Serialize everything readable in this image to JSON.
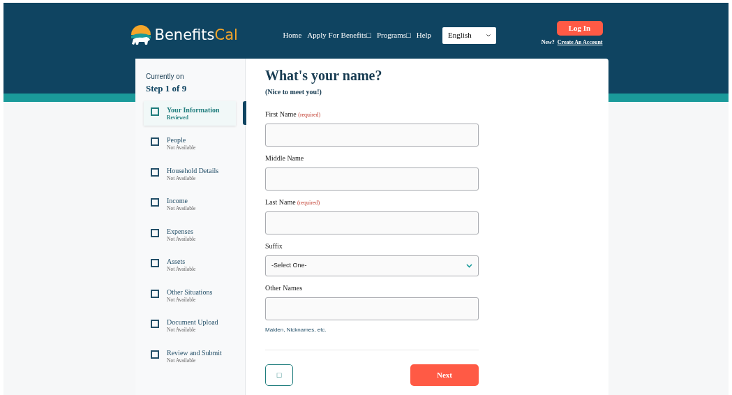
{
  "header": {
    "logo_text": "Benefits",
    "logo_accent": "Cal",
    "nav": [
      {
        "label": "Home"
      },
      {
        "label": "Apply For Benefits□"
      },
      {
        "label": "Programs□"
      },
      {
        "label": "Help"
      }
    ],
    "language": "English",
    "login_button": "Log In",
    "new_prompt": "New?",
    "create_account": "Create An Account"
  },
  "progress": {
    "caption": "Currently on",
    "step_label": "Step 1 of 9",
    "steps": [
      {
        "name": "Your Information",
        "status": "Reviewed",
        "selected": true
      },
      {
        "name": "People",
        "status": "Not Available",
        "selected": false
      },
      {
        "name": "Household Details",
        "status": "Not Available",
        "selected": false
      },
      {
        "name": "Income",
        "status": "Not Available",
        "selected": false
      },
      {
        "name": "Expenses",
        "status": "Not Available",
        "selected": false
      },
      {
        "name": "Assets",
        "status": "Not Available",
        "selected": false
      },
      {
        "name": "Other Situations",
        "status": "Not Available",
        "selected": false
      },
      {
        "name": "Document Upload",
        "status": "Not Available",
        "selected": false
      },
      {
        "name": "Review and Submit",
        "status": "Not Available",
        "selected": false
      }
    ]
  },
  "form": {
    "title": "What's your name?",
    "subtitle": "(Nice to meet you!)",
    "fields": [
      {
        "kind": "text",
        "label": "First Name",
        "required_note": "(required)"
      },
      {
        "kind": "text",
        "label": "Middle Name"
      },
      {
        "kind": "text",
        "label": "Last Name",
        "required_note": "(required)"
      },
      {
        "kind": "select",
        "label": "Suffix",
        "value": "-Select One-"
      },
      {
        "kind": "text",
        "label": "Other Names",
        "hint": "Maiden, Nicknames, etc."
      }
    ],
    "back_button": "□",
    "next_button": "Next"
  }
}
